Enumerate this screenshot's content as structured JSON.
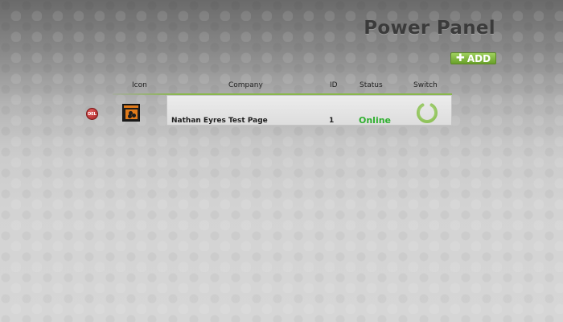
{
  "header": {
    "title": "Power Panel",
    "add_label": "ADD"
  },
  "table": {
    "columns": [
      "Icon",
      "Company",
      "ID",
      "Status",
      "Switch"
    ],
    "rows": [
      {
        "delete_label": "DEL",
        "icon": "company-logo-icon",
        "company": "Nathan Eyres Test Page",
        "id": "1",
        "status": "Online",
        "switch_icon": "power-icon"
      }
    ]
  },
  "colors": {
    "accent_green": "#89b84c",
    "status_online": "#2fb02f",
    "delete_red": "#b82a2a",
    "icon_orange": "#e07a1a"
  }
}
